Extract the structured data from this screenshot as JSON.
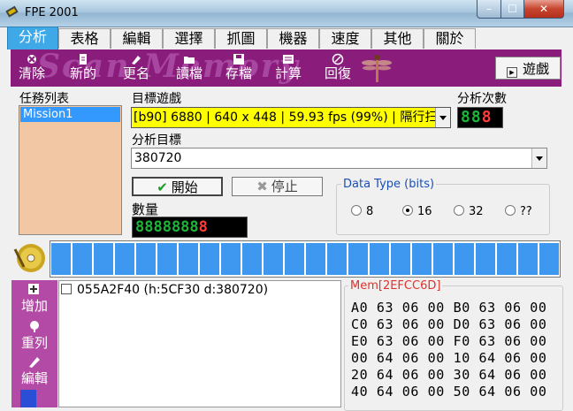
{
  "window": {
    "title": "FPE 2001",
    "min": "–",
    "max": "☐",
    "close": "✕"
  },
  "tabs": [
    {
      "label": "分析",
      "active": true
    },
    {
      "label": "表格"
    },
    {
      "label": "編輯"
    },
    {
      "label": "選擇"
    },
    {
      "label": "抓圖"
    },
    {
      "label": "機器"
    },
    {
      "label": "速度"
    },
    {
      "label": "其他"
    },
    {
      "label": "關於"
    }
  ],
  "toolbar": {
    "watermark": "Scan Memory",
    "items": [
      {
        "label": "清除",
        "icon": "clear-icon"
      },
      {
        "label": "新的",
        "icon": "new-icon"
      },
      {
        "label": "更名",
        "icon": "rename-icon"
      },
      {
        "label": "讀檔",
        "icon": "open-file-icon"
      },
      {
        "label": "存檔",
        "icon": "save-icon"
      },
      {
        "label": "計算",
        "icon": "calculator-icon"
      },
      {
        "label": "回復",
        "icon": "undo-icon"
      }
    ],
    "play_button": "遊戲"
  },
  "task_list": {
    "label": "任務列表",
    "items": [
      "Mission1"
    ]
  },
  "target_game": {
    "label": "目標遊戲",
    "value": "[b90] 6880 | 640 x 448 | 59.93 fps (99%) | 隔行扫"
  },
  "analysis_count": {
    "label": "分析次數",
    "digits": "88",
    "highlight": "8"
  },
  "analysis_target": {
    "label": "分析目標",
    "value": "380720"
  },
  "buttons": {
    "start": "開始",
    "stop": "停止"
  },
  "quantity": {
    "label": "數量",
    "digits": "8888888",
    "highlight": "8"
  },
  "data_type": {
    "title": "Data Type (bits)",
    "options": [
      {
        "label": "8",
        "selected": false
      },
      {
        "label": "16",
        "selected": true
      },
      {
        "label": "32",
        "selected": false
      },
      {
        "label": "??",
        "selected": false
      }
    ]
  },
  "progress": {
    "cells": 24
  },
  "side_tools": [
    {
      "label": "增加",
      "icon": "add-icon"
    },
    {
      "label": "重列",
      "icon": "relist-icon"
    },
    {
      "label": "編輯",
      "icon": "edit-icon"
    }
  ],
  "results": [
    "055A2F40 (h:5CF30 d:380720)"
  ],
  "memory": {
    "title": "Mem[2EFCC6D]",
    "lines": [
      "A0 63 06 00 B0 63 06 00",
      "C0 63 06 00 D0 63 06 00",
      "E0 63 06 00 F0 63 06 00",
      "00 64 06 00 10 64 06 00",
      "20 64 06 00 30 64 06 00",
      "40 64 06 00 50 64 06 00"
    ]
  }
}
